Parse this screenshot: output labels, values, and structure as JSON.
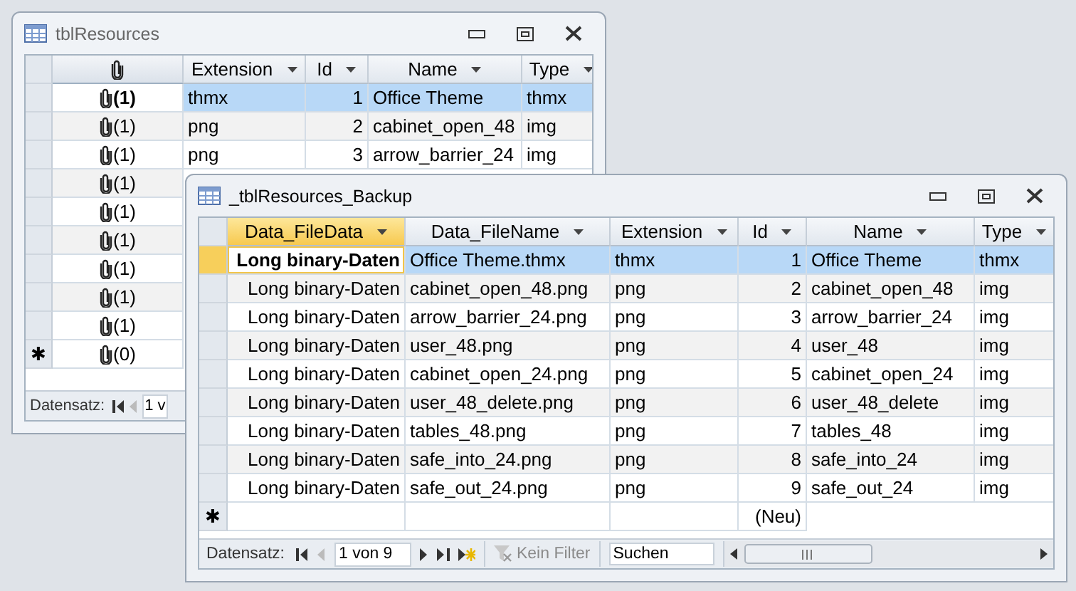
{
  "windows": [
    {
      "title": "tblResources",
      "active": false,
      "columns": [
        {
          "kind": "attachment",
          "selected": true
        },
        {
          "kind": "text",
          "label": "Extension",
          "selected": false
        },
        {
          "kind": "number",
          "label": "Id",
          "selected": false
        },
        {
          "kind": "text",
          "label": "Name",
          "selected": false
        },
        {
          "kind": "text",
          "label": "Type",
          "selected": false
        }
      ],
      "rows": [
        {
          "selected": true,
          "cells": [
            "(1)",
            "thmx",
            "1",
            "Office Theme",
            "thmx"
          ]
        },
        {
          "selected": false,
          "cells": [
            "(1)",
            "png",
            "2",
            "cabinet_open_48",
            "img"
          ]
        },
        {
          "selected": false,
          "cells": [
            "(1)",
            "png",
            "3",
            "arrow_barrier_24",
            "img"
          ]
        },
        {
          "selected": false,
          "cells": [
            "(1)"
          ]
        },
        {
          "selected": false,
          "cells": [
            "(1)"
          ]
        },
        {
          "selected": false,
          "cells": [
            "(1)"
          ]
        },
        {
          "selected": false,
          "cells": [
            "(1)"
          ]
        },
        {
          "selected": false,
          "cells": [
            "(1)"
          ]
        },
        {
          "selected": false,
          "cells": [
            "(1)"
          ]
        }
      ],
      "new_row": {
        "marker": "✱",
        "cells": [
          "(0)"
        ]
      },
      "nav": {
        "label": "Datensatz:",
        "items": [
          {
            "kind": "first",
            "disabled": false
          },
          {
            "kind": "prev",
            "disabled": true
          },
          {
            "kind": "record",
            "text": "1 v"
          }
        ]
      }
    },
    {
      "title": "_tblResources_Backup",
      "active": true,
      "columns": [
        {
          "kind": "binary",
          "label": "Data_FileData",
          "selected": true
        },
        {
          "kind": "text",
          "label": "Data_FileName",
          "selected": false
        },
        {
          "kind": "text",
          "label": "Extension",
          "selected": false
        },
        {
          "kind": "number",
          "label": "Id",
          "selected": false
        },
        {
          "kind": "text",
          "label": "Name",
          "selected": false
        },
        {
          "kind": "text",
          "label": "Type",
          "selected": false
        }
      ],
      "rows": [
        {
          "selected": true,
          "cells": [
            "Long binary-Daten",
            "Office Theme.thmx",
            "thmx",
            "1",
            "Office Theme",
            "thmx"
          ]
        },
        {
          "selected": false,
          "cells": [
            "Long binary-Daten",
            "cabinet_open_48.png",
            "png",
            "2",
            "cabinet_open_48",
            "img"
          ]
        },
        {
          "selected": false,
          "cells": [
            "Long binary-Daten",
            "arrow_barrier_24.png",
            "png",
            "3",
            "arrow_barrier_24",
            "img"
          ]
        },
        {
          "selected": false,
          "cells": [
            "Long binary-Daten",
            "user_48.png",
            "png",
            "4",
            "user_48",
            "img"
          ]
        },
        {
          "selected": false,
          "cells": [
            "Long binary-Daten",
            "cabinet_open_24.png",
            "png",
            "5",
            "cabinet_open_24",
            "img"
          ]
        },
        {
          "selected": false,
          "cells": [
            "Long binary-Daten",
            "user_48_delete.png",
            "png",
            "6",
            "user_48_delete",
            "img"
          ]
        },
        {
          "selected": false,
          "cells": [
            "Long binary-Daten",
            "tables_48.png",
            "png",
            "7",
            "tables_48",
            "img"
          ]
        },
        {
          "selected": false,
          "cells": [
            "Long binary-Daten",
            "safe_into_24.png",
            "png",
            "8",
            "safe_into_24",
            "img"
          ]
        },
        {
          "selected": false,
          "cells": [
            "Long binary-Daten",
            "safe_out_24.png",
            "png",
            "9",
            "safe_out_24",
            "img"
          ]
        }
      ],
      "new_row": {
        "marker": "✱",
        "cells": [
          "",
          "",
          "",
          "(Neu)"
        ]
      },
      "nav": {
        "label": "Datensatz:",
        "items": [
          {
            "kind": "first",
            "disabled": false
          },
          {
            "kind": "prev",
            "disabled": true
          },
          {
            "kind": "record",
            "text": "1 von 9"
          },
          {
            "kind": "next",
            "disabled": false
          },
          {
            "kind": "last",
            "disabled": false
          },
          {
            "kind": "new",
            "disabled": false
          },
          {
            "kind": "filter",
            "text": "Kein Filter",
            "disabled": true
          },
          {
            "kind": "search",
            "placeholder": "Suchen"
          },
          {
            "kind": "scrollbar"
          }
        ]
      }
    }
  ]
}
